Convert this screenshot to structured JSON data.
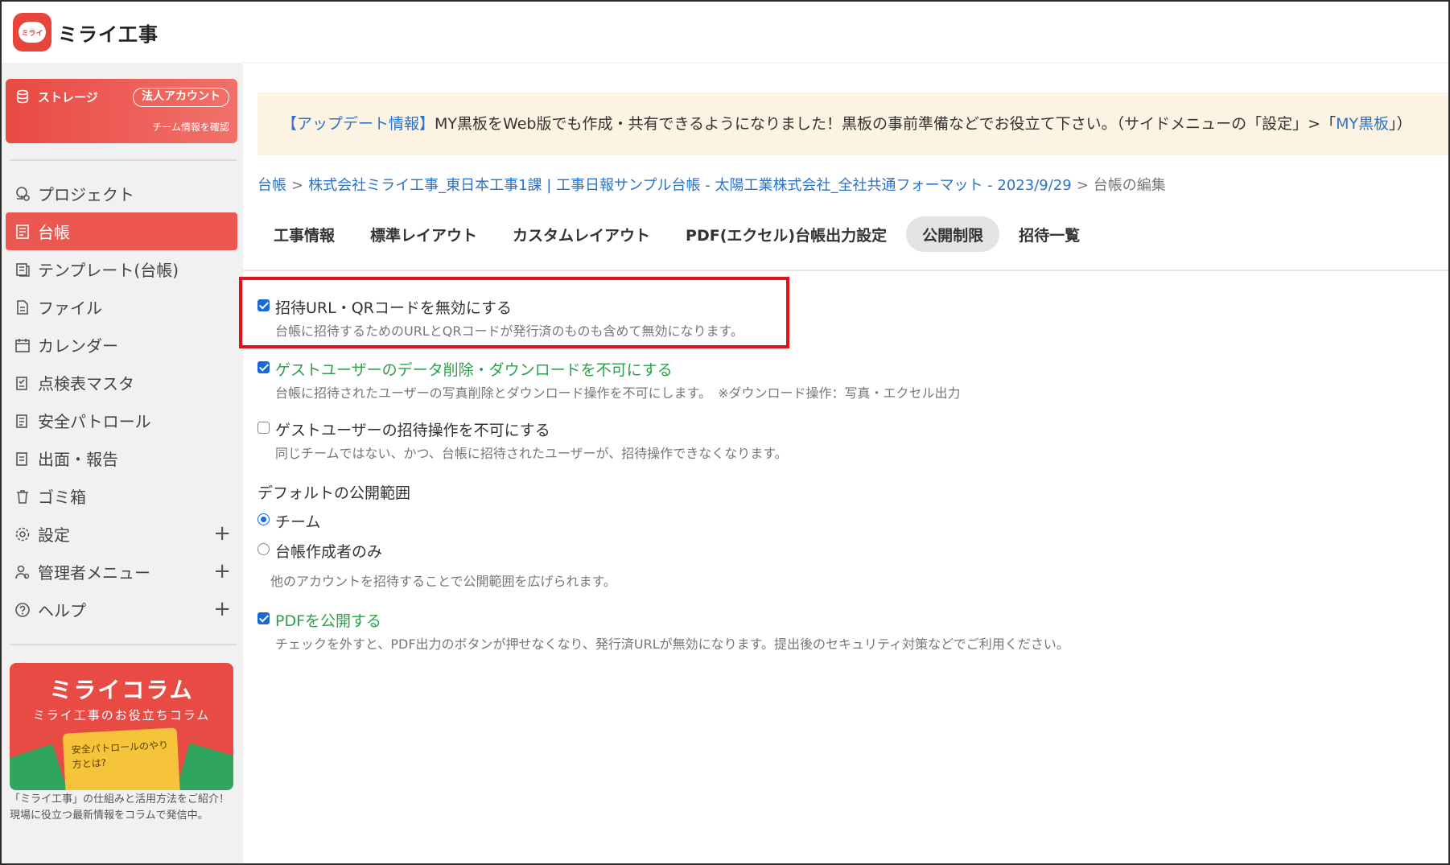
{
  "app": {
    "logo_text": "ミライ工事",
    "logo_mark_text": "ミライ"
  },
  "storage": {
    "title": "ストレージ",
    "badge": "法人アカウント",
    "team_link": "チーム情報を確認"
  },
  "sidebar": {
    "items": [
      {
        "label": "プロジェクト",
        "icon": "project-icon"
      },
      {
        "label": "台帳",
        "icon": "ledger-icon",
        "active": true
      },
      {
        "label": "テンプレート(台帳)",
        "icon": "template-icon"
      },
      {
        "label": "ファイル",
        "icon": "file-icon"
      },
      {
        "label": "カレンダー",
        "icon": "calendar-icon"
      },
      {
        "label": "点検表マスタ",
        "icon": "checklist-icon"
      },
      {
        "label": "安全パトロール",
        "icon": "patrol-icon"
      },
      {
        "label": "出面・報告",
        "icon": "report-icon"
      },
      {
        "label": "ゴミ箱",
        "icon": "trash-icon"
      },
      {
        "label": "設定",
        "icon": "gear-icon",
        "expandable": true
      },
      {
        "label": "管理者メニュー",
        "icon": "admin-icon",
        "expandable": true
      },
      {
        "label": "ヘルプ",
        "icon": "help-icon",
        "expandable": true
      }
    ],
    "expand_symbol": "+"
  },
  "column": {
    "title": "ミライコラム",
    "subtitle": "ミライ工事のお役立ちコラム",
    "book_text": "安全パトロールのやり方とは?",
    "description": "「ミライ工事」の仕組みと活用方法をご紹介！現場に役立つ最新情報をコラムで発信中。"
  },
  "notice": {
    "tag": "【アップデート情報】",
    "text": "MY黒板をWeb版でも作成・共有できるようになりました！黒板の事前準備などでお役立て下さい。（サイドメニューの「設定」>「",
    "link": "MY黒板",
    "tail": "」）"
  },
  "breadcrumb": {
    "root": "台帳",
    "ledger": "株式会社ミライ工事_東日本工事1課 | 工事日報サンプル台帳 - 太陽工業株式会社_全社共通フォーマット - 2023/9/29",
    "current": "台帳の編集",
    "separator": ">"
  },
  "tabs": [
    {
      "label": "工事情報"
    },
    {
      "label": "標準レイアウト"
    },
    {
      "label": "カスタムレイアウト"
    },
    {
      "label": "PDF(エクセル)台帳出力設定"
    },
    {
      "label": "公開制限",
      "active": true
    },
    {
      "label": "招待一覧"
    }
  ],
  "options": {
    "disable_invite_url": {
      "label": "招待URL・QRコードを無効にする",
      "desc": "台帳に招待するためのURLとQRコードが発行済のものも含めて無効になります。",
      "checked": true
    },
    "disable_guest_download": {
      "label": "ゲストユーザーのデータ削除・ダウンロードを不可にする",
      "desc": "台帳に招待されたユーザーの写真削除とダウンロード操作を不可にします。　※ダウンロード操作：写真・エクセル出力",
      "checked": true
    },
    "disable_guest_invite": {
      "label": "ゲストユーザーの招待操作を不可にする",
      "desc": "同じチームではない、かつ、台帳に招待されたユーザーが、招待操作できなくなります。",
      "checked": false
    },
    "publish_pdf": {
      "label": "PDFを公開する",
      "desc": "チェックを外すと、PDF出力のボタンが押せなくなり、発行済URLが無効になります。提出後のセキュリティ対策などでご利用ください。",
      "checked": true
    }
  },
  "visibility": {
    "title": "デフォルトの公開範囲",
    "options": [
      {
        "label": "チーム",
        "selected": true
      },
      {
        "label": "台帳作成者のみ",
        "selected": false
      }
    ],
    "note": "他のアカウントを招待することで公開範囲を広げられます。"
  },
  "colors": {
    "accent": "#ed5752",
    "link": "#2b73c9",
    "green": "#2f9f4b",
    "highlight": "#e0121a",
    "checkbox": "#1a6ad6"
  }
}
